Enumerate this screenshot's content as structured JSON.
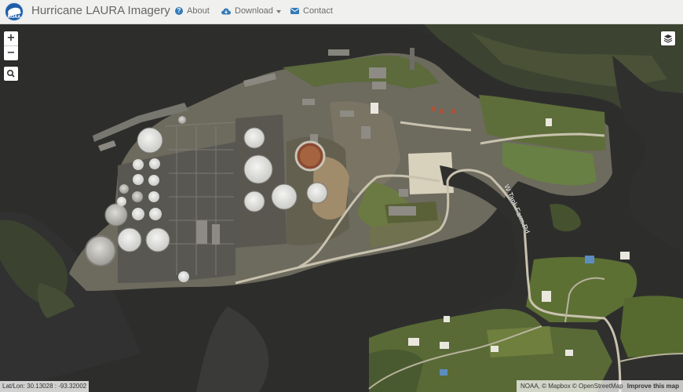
{
  "header": {
    "logo_text": "NOAA",
    "title": "Hurricane LAURA Imagery",
    "nav": [
      {
        "label": "About",
        "icon": "question-circle-icon"
      },
      {
        "label": "Download",
        "icon": "cloud-download-icon",
        "has_dropdown": true
      },
      {
        "label": "Contact",
        "icon": "envelope-icon"
      }
    ],
    "accent_color": "#337ab7"
  },
  "map": {
    "controls": {
      "zoom_in": "+",
      "zoom_out": "−",
      "search_icon": "search-icon",
      "layers_icon": "layers-icon"
    },
    "road_label": "W Tank Farm Rd",
    "latlon_label": "Lat/Lon:",
    "lat": "30.13028",
    "lon": "-93.32002",
    "attribution": {
      "prefix": "NOAA, © Mapbox © OpenStreetMap",
      "improve": "Improve this map"
    }
  }
}
